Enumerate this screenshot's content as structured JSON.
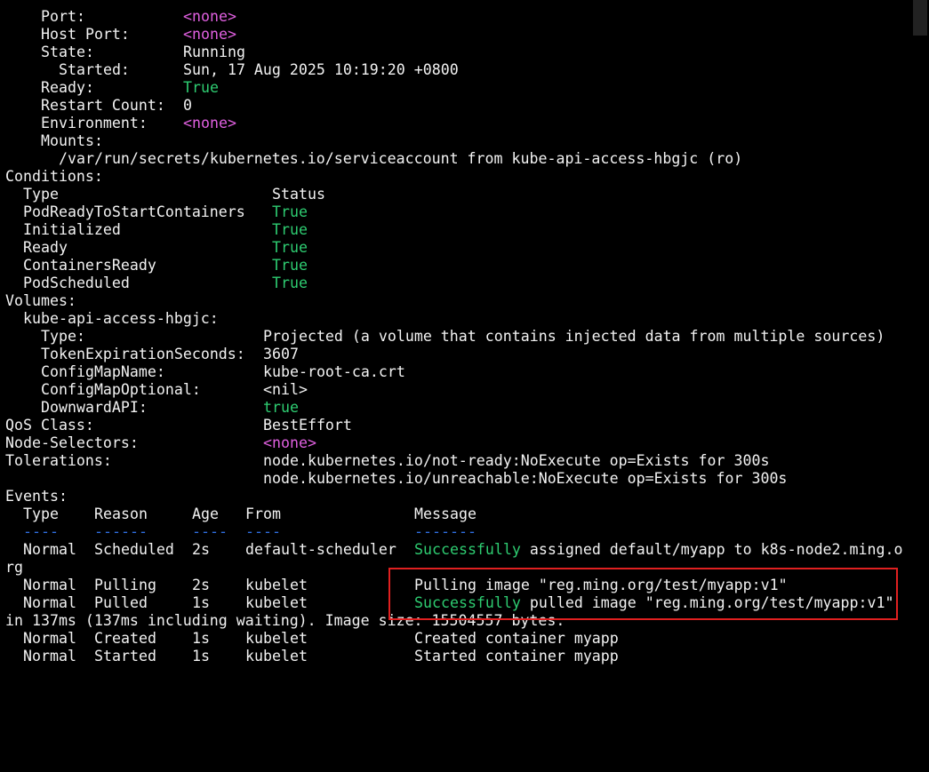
{
  "container": {
    "port_label": "Port:",
    "port_value": "<none>",
    "hostport_label": "Host Port:",
    "hostport_value": "<none>",
    "state_label": "State:",
    "state_value": "Running",
    "started_label": "Started:",
    "started_value": "Sun, 17 Aug 2025 10:19:20 +0800",
    "ready_label": "Ready:",
    "ready_value": "True",
    "restart_label": "Restart Count:",
    "restart_value": "0",
    "env_label": "Environment:",
    "env_value": "<none>",
    "mounts_label": "Mounts:",
    "mount_path": "/var/run/secrets/kubernetes.io/serviceaccount from kube-api-access-hbgjc (ro)"
  },
  "conditions": {
    "title": "Conditions:",
    "col_type": "Type",
    "col_status": "Status",
    "rows": [
      {
        "type": "PodReadyToStartContainers",
        "status": "True"
      },
      {
        "type": "Initialized",
        "status": "True"
      },
      {
        "type": "Ready",
        "status": "True"
      },
      {
        "type": "ContainersReady",
        "status": "True"
      },
      {
        "type": "PodScheduled",
        "status": "True"
      }
    ]
  },
  "volumes": {
    "title": "Volumes:",
    "name": "kube-api-access-hbgjc:",
    "type_label": "Type:",
    "type_value": "Projected (a volume that contains injected data from multiple sources)",
    "token_label": "TokenExpirationSeconds:",
    "token_value": "3607",
    "cmname_label": "ConfigMapName:",
    "cmname_value": "kube-root-ca.crt",
    "cmopt_label": "ConfigMapOptional:",
    "cmopt_value": "<nil>",
    "downward_label": "DownwardAPI:",
    "downward_value": "true"
  },
  "qos": {
    "label": "QoS Class:",
    "value": "BestEffort"
  },
  "node_selectors": {
    "label": "Node-Selectors:",
    "value": "<none>"
  },
  "tolerations": {
    "label": "Tolerations:",
    "values": [
      "node.kubernetes.io/not-ready:NoExecute op=Exists for 300s",
      "node.kubernetes.io/unreachable:NoExecute op=Exists for 300s"
    ]
  },
  "events": {
    "title": "Events:",
    "headers": {
      "type": "Type",
      "reason": "Reason",
      "age": "Age",
      "from": "From",
      "message": "Message"
    },
    "dashes": {
      "type": "----",
      "reason": "------",
      "age": "----",
      "from": "----",
      "message": "-------"
    },
    "rows": [
      {
        "type": "Normal",
        "reason": "Scheduled",
        "age": "2s",
        "from": "default-scheduler",
        "msg_highlight": "Successfully",
        "msg_rest": " assigned default/myapp to k8s-node2.ming.o",
        "wrap": "rg"
      },
      {
        "type": "Normal",
        "reason": "Pulling",
        "age": "2s",
        "from": "kubelet",
        "msg_highlight": "",
        "msg_rest": "Pulling image \"reg.ming.org/test/myapp:v1\"",
        "wrap": ""
      },
      {
        "type": "Normal",
        "reason": "Pulled",
        "age": "1s",
        "from": "kubelet",
        "msg_highlight": "Successfully",
        "msg_rest": " pulled image \"reg.ming.org/test/myapp:v1\"",
        "wrap": "in 137ms (137ms including waiting). Image size: 15504557 bytes."
      },
      {
        "type": "Normal",
        "reason": "Created",
        "age": "1s",
        "from": "kubelet",
        "msg_highlight": "",
        "msg_rest": "Created container myapp",
        "wrap": ""
      },
      {
        "type": "Normal",
        "reason": "Started",
        "age": "1s",
        "from": "kubelet",
        "msg_highlight": "",
        "msg_rest": "Started container myapp",
        "wrap": ""
      }
    ]
  },
  "colors": {
    "magenta": "#e060e0",
    "green": "#2ecc71",
    "highlight_box": "#e02020"
  }
}
